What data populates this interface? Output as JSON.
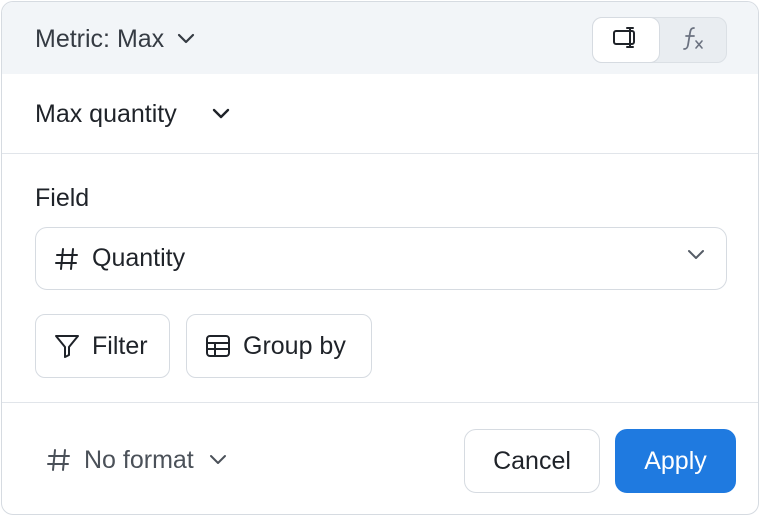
{
  "header": {
    "metric_label": "Metric: Max",
    "mode_toggle": {
      "options": [
        {
          "id": "visual",
          "icon": "column-cursor-icon",
          "active": true
        },
        {
          "id": "formula",
          "icon": "function-icon",
          "active": false
        }
      ]
    }
  },
  "name": {
    "value": "Max quantity"
  },
  "field": {
    "label": "Field",
    "value": "Quantity",
    "type_icon": "hash-icon"
  },
  "actions": {
    "filter_label": "Filter",
    "group_by_label": "Group by"
  },
  "footer": {
    "format_label": "No format",
    "cancel_label": "Cancel",
    "apply_label": "Apply"
  },
  "colors": {
    "accent": "#1f7ae0",
    "header_bg": "#f2f5f8",
    "border": "#d6dbe1",
    "text": "#1f2329"
  }
}
